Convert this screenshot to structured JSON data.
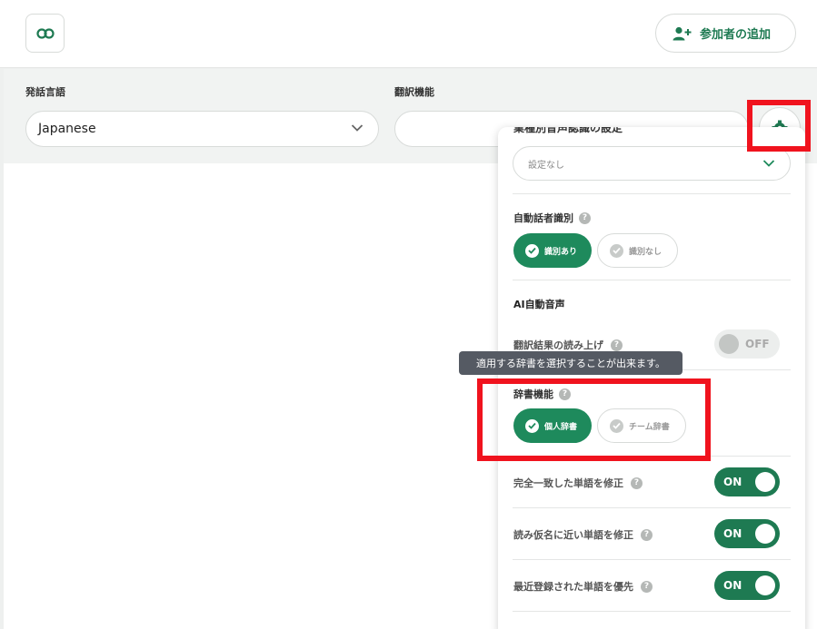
{
  "header": {
    "link_icon": "link-icon",
    "add_participant_label": "参加者の追加",
    "add_participant_icon": "person-add-icon"
  },
  "controls": {
    "speech_language_label": "発話言語",
    "speech_language_value": "Japanese",
    "translation_label": "翻訳機能",
    "translation_value": "",
    "settings_icon": "gear-icon"
  },
  "panel": {
    "cut_label": "業種別音声認識の設定",
    "industry_select_value": "設定なし",
    "speaker_id_title": "自動話者識別",
    "speaker_id_options": [
      "識別あり",
      "識別なし"
    ],
    "speaker_id_selected": "識別あり",
    "ai_voice_title": "AI自動音声",
    "read_aloud_label": "翻訳結果の読み上げ",
    "read_aloud_state": "OFF",
    "dictionary_title": "辞書機能",
    "dictionary_options": [
      "個人辞書",
      "チーム辞書"
    ],
    "dictionary_selected": "個人辞書",
    "exact_match_label": "完全一致した単語を修正",
    "exact_match_state": "ON",
    "kana_near_label": "読み仮名に近い単語を修正",
    "kana_near_state": "ON",
    "recent_label": "最近登録された単語を優先",
    "recent_state": "ON",
    "help_glyph": "?"
  },
  "tooltip": {
    "text": "適用する辞書を選択することが出来ます。"
  },
  "colors": {
    "accent": "#1e7a52",
    "highlight": "#f0131e"
  }
}
